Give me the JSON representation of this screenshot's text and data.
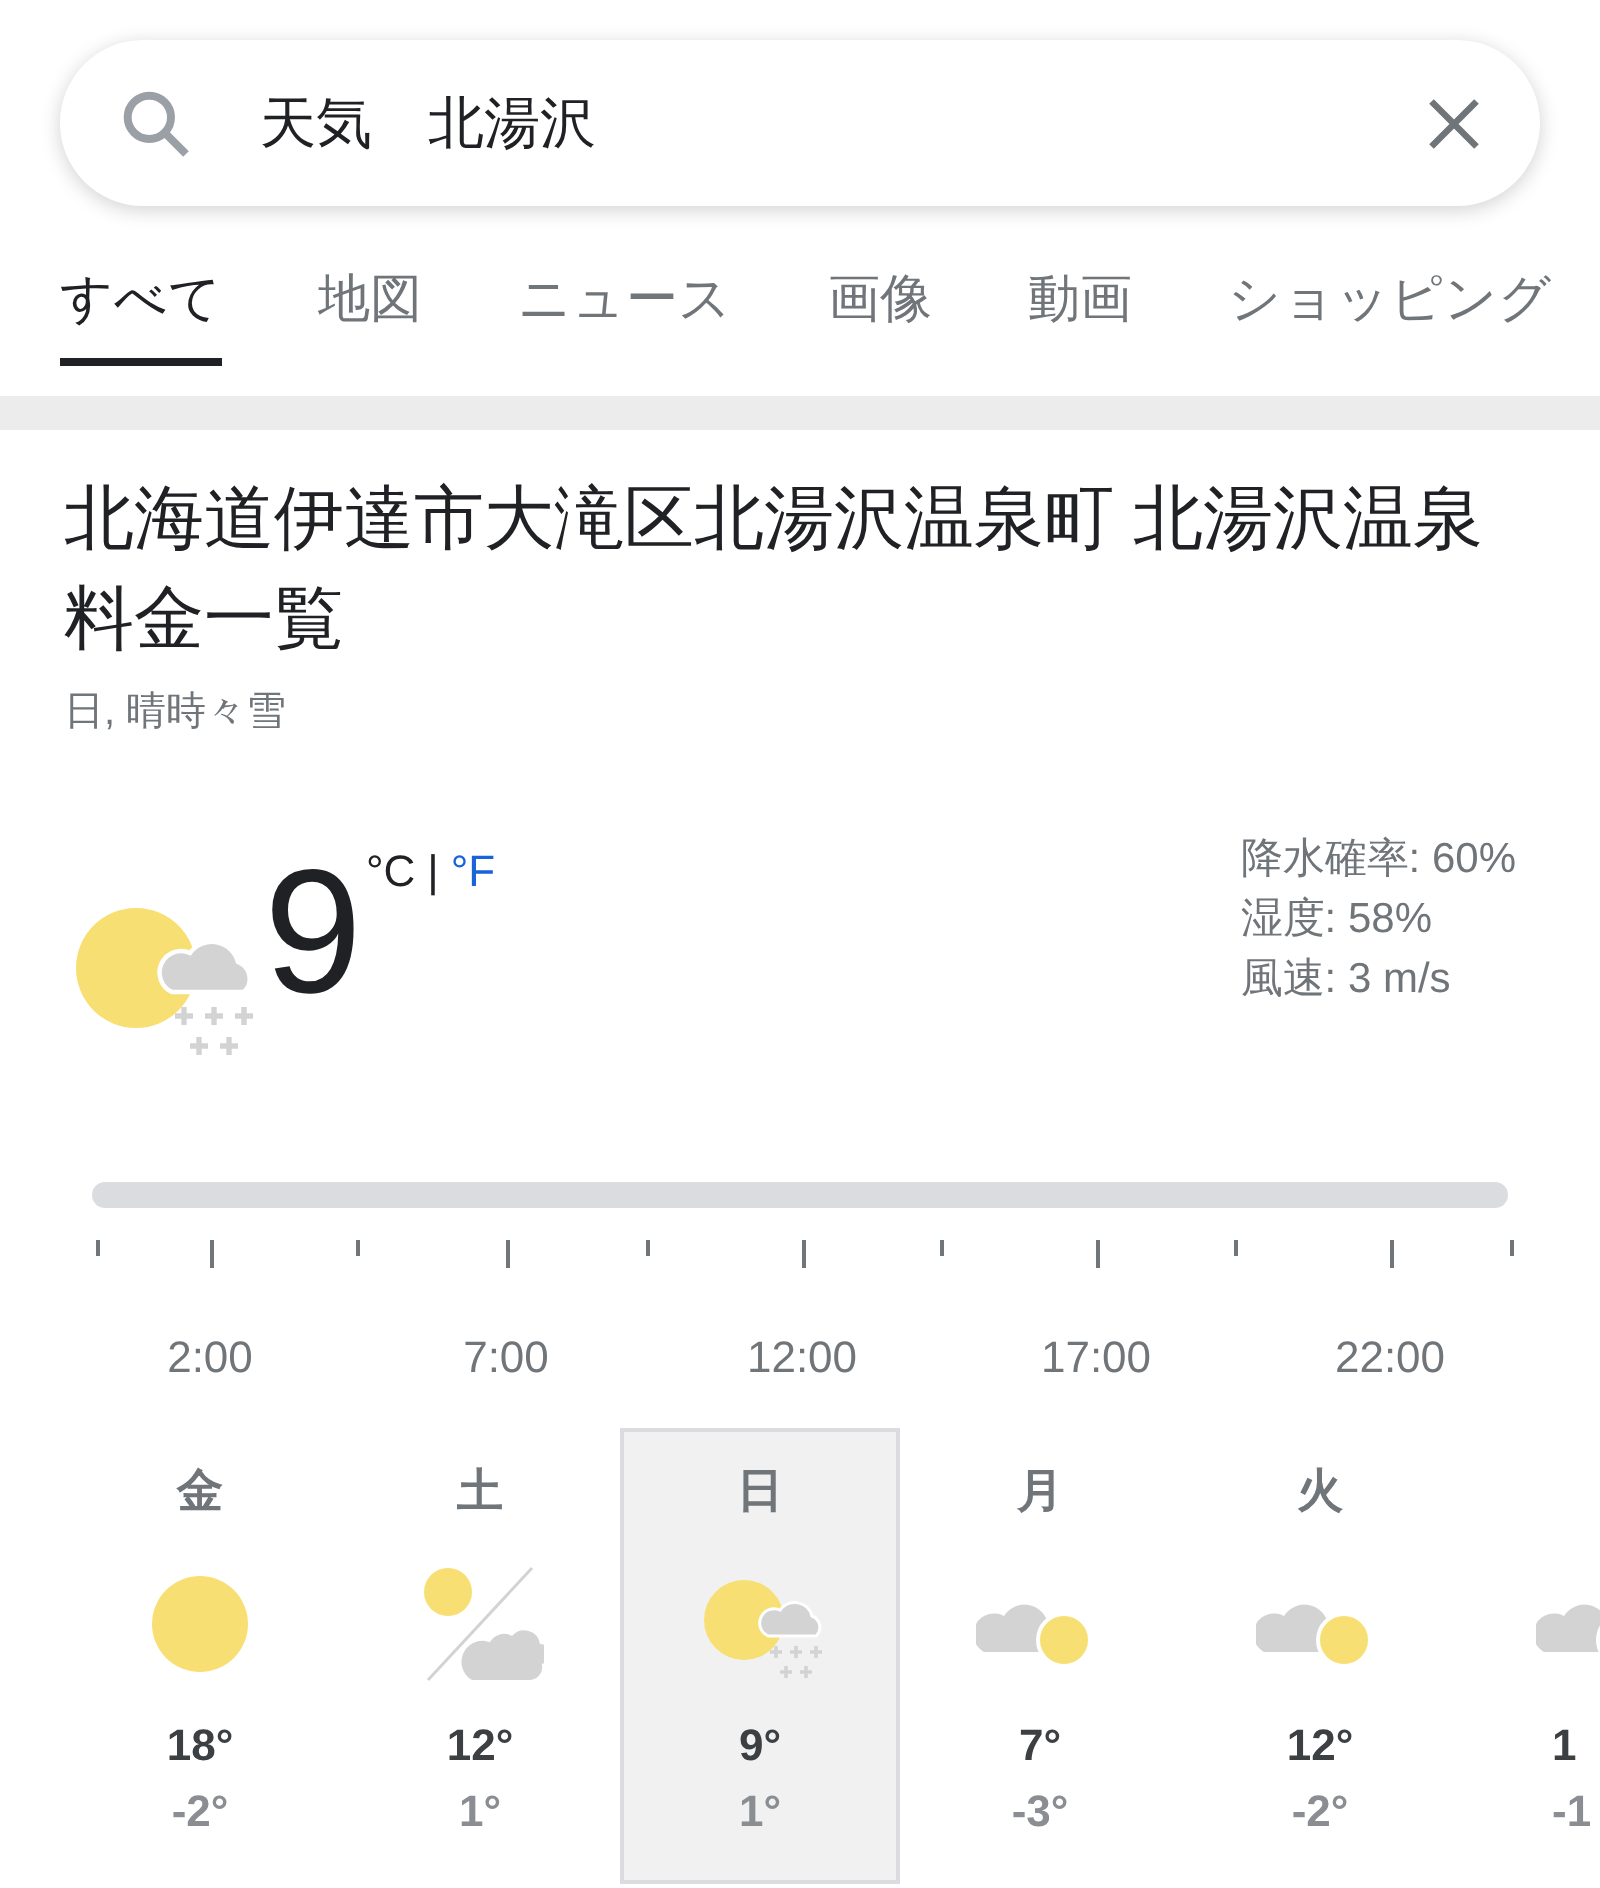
{
  "search": {
    "value": "天気　北湯沢"
  },
  "tabs": [
    {
      "label": "すべて",
      "selected": true
    },
    {
      "label": "地図",
      "selected": false
    },
    {
      "label": "ニュース",
      "selected": false
    },
    {
      "label": "画像",
      "selected": false
    },
    {
      "label": "動画",
      "selected": false
    },
    {
      "label": "ショッピング",
      "selected": false
    }
  ],
  "location": "北海道伊達市大滝区北湯沢温泉町 北湯沢温泉料金一覧",
  "condition": "日, 晴時々雪",
  "current": {
    "kind": "sun_snow",
    "temperature": "9",
    "unit_c": "°C",
    "separator": "|",
    "unit_f": "°F",
    "details": [
      "降水確率: 60%",
      "湿度: 58%",
      "風速: 3 m/s"
    ]
  },
  "timeline": {
    "labels": [
      "2:00",
      "7:00",
      "12:00",
      "17:00",
      "22:00"
    ]
  },
  "days": [
    {
      "day": "金",
      "kind": "sunny",
      "high": "18°",
      "low": "-2°",
      "selected": false
    },
    {
      "day": "土",
      "kind": "sun_cloud_split",
      "high": "12°",
      "low": "1°",
      "selected": false
    },
    {
      "day": "日",
      "kind": "sun_snow",
      "high": "9°",
      "low": "1°",
      "selected": true
    },
    {
      "day": "月",
      "kind": "cloud_sun",
      "high": "7°",
      "low": "-3°",
      "selected": false
    },
    {
      "day": "火",
      "kind": "cloud_sun",
      "high": "12°",
      "low": "-2°",
      "selected": false
    },
    {
      "kind": "cloud_sun",
      "high": "1",
      "low": "-1",
      "selected": false
    }
  ]
}
